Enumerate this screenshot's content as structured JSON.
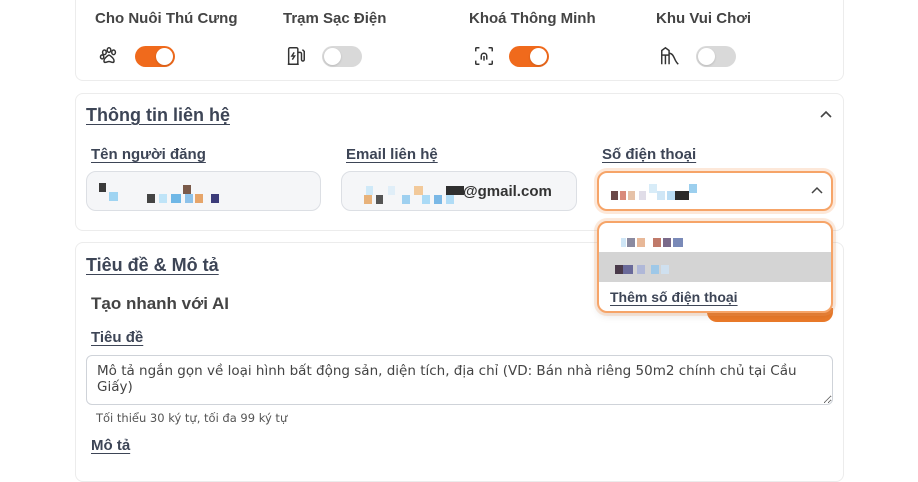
{
  "amenities": [
    {
      "label": "Cho Nuôi Thú Cưng",
      "icon": "paw-icon",
      "on": true
    },
    {
      "label": "Trạm Sạc Điện",
      "icon": "charging-station-icon",
      "on": false
    },
    {
      "label": "Khoá Thông Minh",
      "icon": "smart-lock-icon",
      "on": true
    },
    {
      "label": "Khu Vui Chơi",
      "icon": "playground-icon",
      "on": false
    }
  ],
  "contact": {
    "section_title": "Thông tin liên hệ",
    "name_label": "Tên người đăng",
    "email_label": "Email liên hệ",
    "email_suffix": "@gmail.com",
    "phone_label": "Số điện thoại",
    "add_phone_label": "Thêm số điện thoại"
  },
  "title_section": {
    "section_title": "Tiêu đề & Mô tả",
    "ai_heading": "Tạo nhanh với AI",
    "title_label": "Tiêu đề",
    "title_placeholder": "Mô tả ngắn gọn về loại hình bất động sản, diện tích, địa chỉ (VD: Bán nhà riêng 50m2 chính chủ tại Cầu Giấy)",
    "title_hint": "Tối thiểu 30 ký tự, tối đa 99 ký tự",
    "description_label": "Mô tả"
  },
  "colors": {
    "accent": "#f06a1c",
    "toggle_off": "#d9d9d9",
    "focus_border": "#f6a468"
  }
}
